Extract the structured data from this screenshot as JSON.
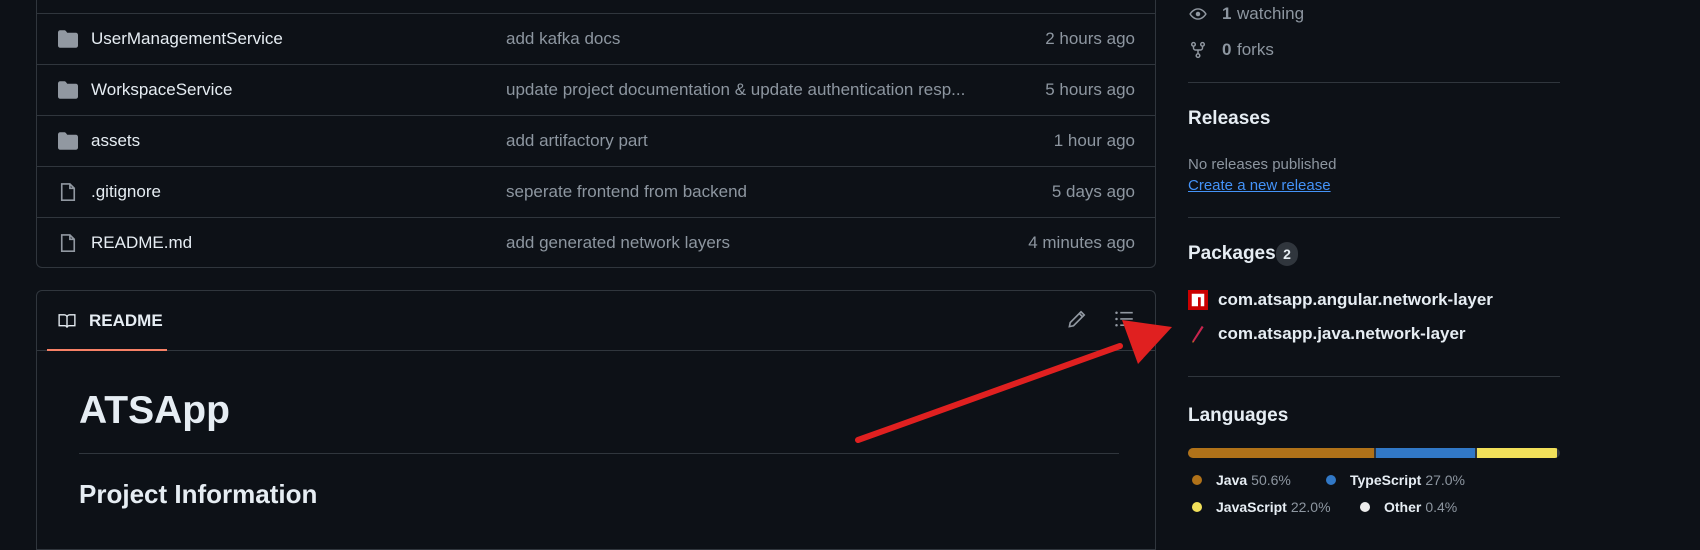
{
  "files": [
    {
      "name": "UserManagementService",
      "type": "folder",
      "message": "add kafka docs",
      "time": "2 hours ago"
    },
    {
      "name": "WorkspaceService",
      "type": "folder",
      "message": "update project documentation & update authentication resp...",
      "time": "5 hours ago"
    },
    {
      "name": "assets",
      "type": "folder",
      "message": "add artifactory part",
      "time": "1 hour ago"
    },
    {
      "name": ".gitignore",
      "type": "file",
      "message": "seperate frontend from backend",
      "time": "5 days ago"
    },
    {
      "name": "README.md",
      "type": "file",
      "message": "add generated network layers",
      "time": "4 minutes ago"
    }
  ],
  "readme": {
    "tab_label": "README",
    "title": "ATSApp",
    "section_heading": "Project Information"
  },
  "sidebar": {
    "watching": {
      "count": "1",
      "label": "watching"
    },
    "forks": {
      "count": "0",
      "label": "forks"
    },
    "releases": {
      "title": "Releases",
      "empty_text": "No releases published",
      "create_link": "Create a new release"
    },
    "packages": {
      "title": "Packages",
      "count": "2",
      "items": [
        {
          "name": "com.atsapp.angular.network-layer",
          "icon": "npm-icon"
        },
        {
          "name": "com.atsapp.java.network-layer",
          "icon": "maven-icon"
        }
      ]
    },
    "languages": {
      "title": "Languages",
      "items": [
        {
          "name": "Java",
          "percent": "50.6%",
          "share": 50.6,
          "color": "#b07219"
        },
        {
          "name": "TypeScript",
          "percent": "27.0%",
          "share": 27.0,
          "color": "#3178c6"
        },
        {
          "name": "JavaScript",
          "percent": "22.0%",
          "share": 22.0,
          "color": "#f1e05a"
        },
        {
          "name": "Other",
          "percent": "0.4%",
          "share": 0.4,
          "color": "#ededed"
        }
      ]
    }
  },
  "colors": {
    "background": "#0d1117",
    "border": "#30363d",
    "link": "#4493f8",
    "annotation": "#e02020"
  }
}
